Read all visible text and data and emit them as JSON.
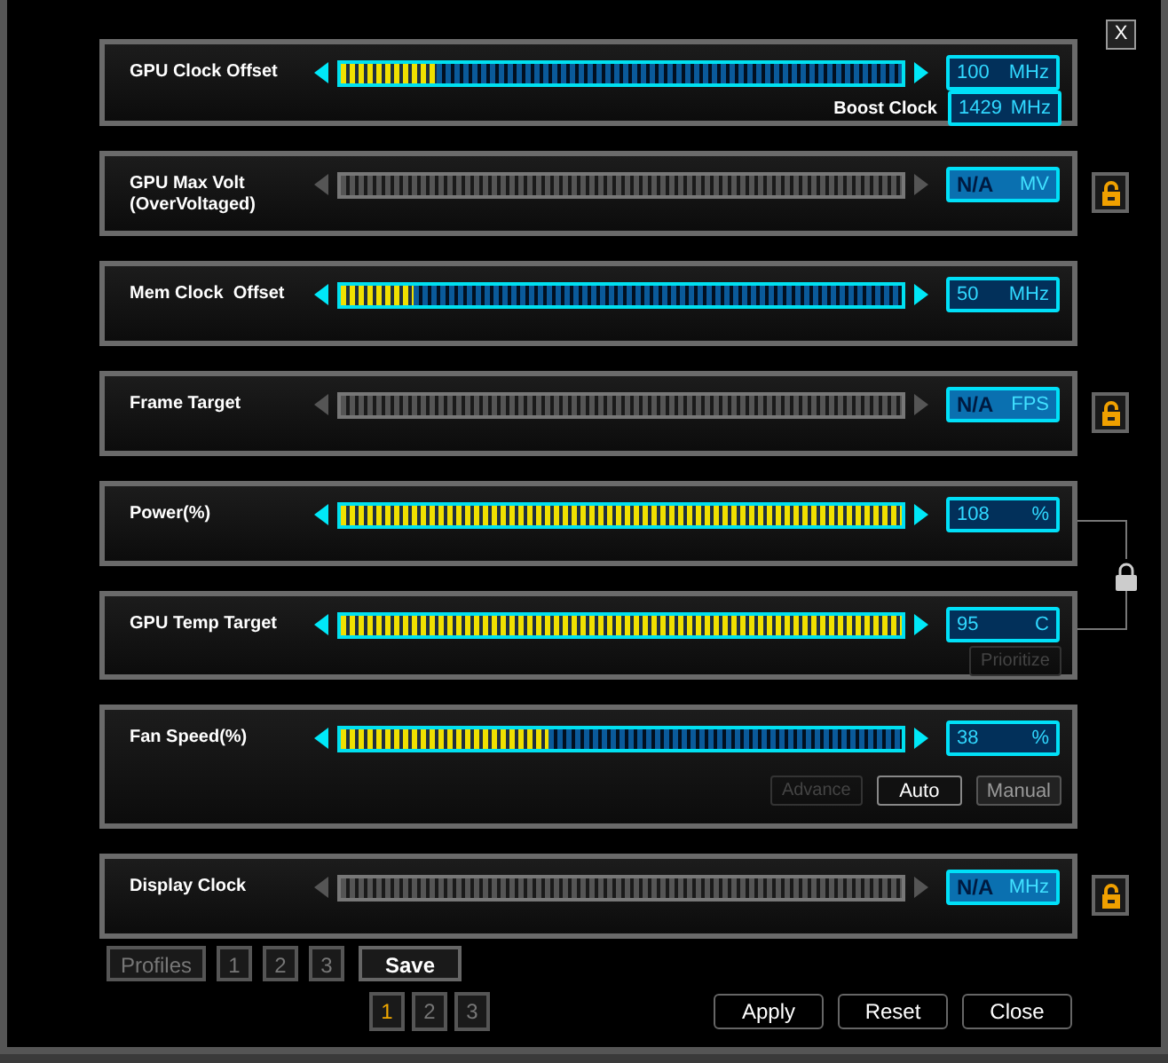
{
  "close_button": "X",
  "rows": [
    {
      "label": "GPU Clock Offset",
      "enabled": true,
      "level": 0.17,
      "value": "100",
      "unit": "MHz",
      "sub": {
        "label": "Boost Clock",
        "value": "1429",
        "unit": "MHz"
      }
    },
    {
      "label": "GPU Max Volt\n(OverVoltaged)",
      "enabled": false,
      "value": "N/A",
      "unit": "MV",
      "lock": true
    },
    {
      "label": "Mem Clock  Offset",
      "enabled": true,
      "level": 0.13,
      "value": "50",
      "unit": "MHz"
    },
    {
      "label": "Frame Target",
      "enabled": false,
      "value": "N/A",
      "unit": "FPS",
      "lock": true
    },
    {
      "label": "Power(%)",
      "enabled": true,
      "level": 1,
      "value": "108",
      "unit": "%",
      "linked": true
    },
    {
      "label": "GPU Temp Target",
      "enabled": true,
      "level": 1,
      "value": "95",
      "unit": "C",
      "buttons": [
        {
          "label": "Prioritize",
          "disabled": true,
          "selected": false
        }
      ]
    },
    {
      "label": "Fan Speed(%)",
      "enabled": true,
      "level": 0.37,
      "value": "38",
      "unit": "%",
      "buttons": [
        {
          "label": "Advance",
          "disabled": true,
          "selected": false
        },
        {
          "label": "Auto",
          "disabled": false,
          "selected": true
        },
        {
          "label": "Manual",
          "disabled": false,
          "selected": false
        }
      ]
    },
    {
      "label": "Display Clock",
      "enabled": false,
      "value": "N/A",
      "unit": "MHz",
      "lock": true
    }
  ],
  "profiles": {
    "label": "Profiles",
    "slots": [
      {
        "label": "1"
      },
      {
        "label": "2"
      },
      {
        "label": "3"
      }
    ],
    "save": "Save",
    "active": [
      {
        "label": "1",
        "selected": true
      },
      {
        "label": "2",
        "selected": false
      },
      {
        "label": "3",
        "selected": false
      }
    ]
  },
  "actions": [
    "Apply",
    "Reset",
    "Close"
  ]
}
